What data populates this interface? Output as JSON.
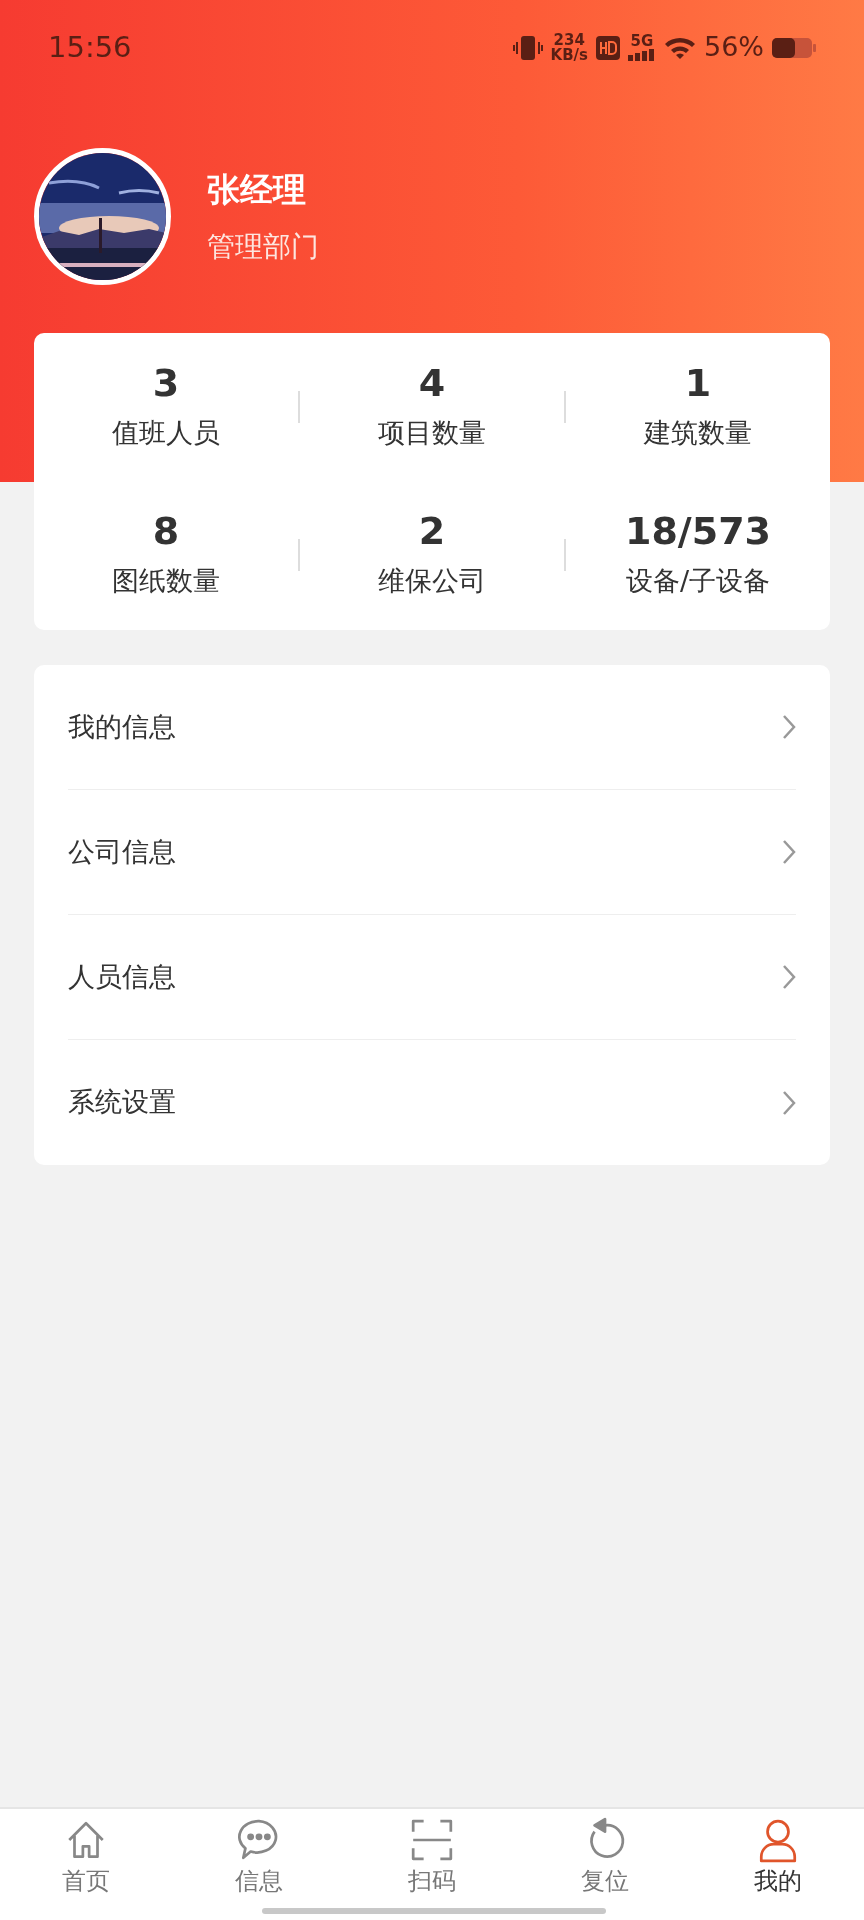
{
  "status_bar": {
    "time": "15:56",
    "net_speed": "234",
    "net_unit": "KB/s",
    "network": "5G",
    "battery_text": "56%"
  },
  "profile": {
    "name": "张经理",
    "department": "管理部门"
  },
  "stats": [
    {
      "value": "3",
      "label": "值班人员"
    },
    {
      "value": "4",
      "label": "项目数量"
    },
    {
      "value": "1",
      "label": "建筑数量"
    },
    {
      "value": "8",
      "label": "图纸数量"
    },
    {
      "value": "2",
      "label": "维保公司"
    },
    {
      "value": "18/573",
      "label": "设备/子设备"
    }
  ],
  "menu": [
    {
      "label": "我的信息"
    },
    {
      "label": "公司信息"
    },
    {
      "label": "人员信息"
    },
    {
      "label": "系统设置"
    }
  ],
  "tab_bar": [
    {
      "kind": "home",
      "label": "首页",
      "selected": false
    },
    {
      "kind": "chat",
      "label": "信息",
      "selected": false
    },
    {
      "kind": "scan",
      "label": "扫码",
      "selected": false
    },
    {
      "kind": "reset",
      "label": "复位",
      "selected": false
    },
    {
      "kind": "user",
      "label": "我的",
      "selected": true
    }
  ]
}
